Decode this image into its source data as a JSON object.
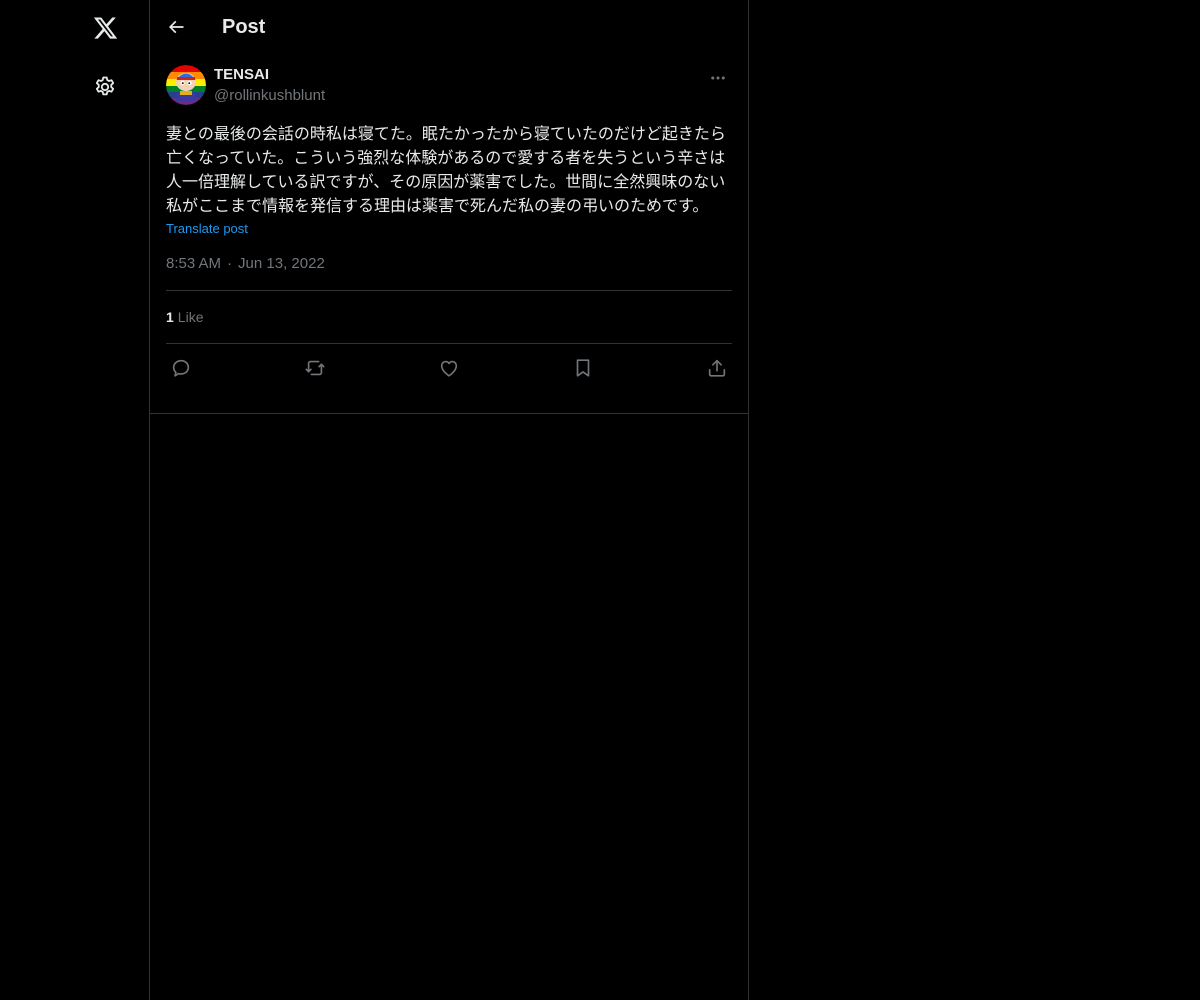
{
  "header": {
    "title": "Post"
  },
  "post": {
    "author_name": "TENSAI",
    "author_handle": "@rollinkushblunt",
    "text": "妻との最後の会話の時私は寝てた。眠たかったから寝ていたのだけど起きたら亡くなっていた。こういう強烈な体験があるので愛する者を失うという辛さは人一倍理解している訳ですが、その原因が薬害でした。世間に全然興味のない私がここまで情報を発信する理由は薬害で死んだ私の妻の弔いのためです。",
    "translate_label": "Translate post",
    "time": "8:53 AM",
    "separator": "·",
    "date": "Jun 13, 2022",
    "like_count": "1",
    "like_label": "Like"
  },
  "icons": {
    "logo": "x-logo-icon",
    "settings": "gear-icon",
    "back": "arrow-left-icon",
    "more": "more-horizontal-icon",
    "reply": "reply-icon",
    "repost": "repost-icon",
    "like": "heart-icon",
    "bookmark": "bookmark-icon",
    "share": "share-icon"
  },
  "colors": {
    "background": "#000000",
    "text_primary": "#e7e9ea",
    "text_secondary": "#71767b",
    "accent": "#1d9bf0",
    "border": "#2f3336"
  }
}
